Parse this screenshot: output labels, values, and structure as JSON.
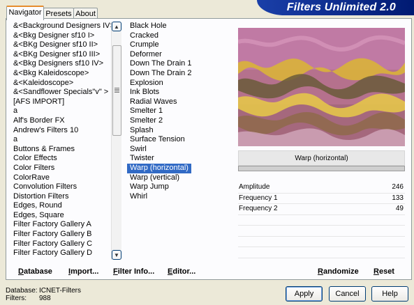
{
  "tabs": [
    "Navigator",
    "Presets",
    "About"
  ],
  "banner_title": "Filters Unlimited 2.0",
  "categories": [
    "&<Background Designers IV>",
    "&<Bkg Designer sf10 I>",
    "&<BKg Designer sf10 II>",
    "&<BKg Designer sf10 III>",
    "&<Bkg Designers sf10 IV>",
    "&<Bkg Kaleidoscope>",
    "&<Kaleidoscope>",
    "&<Sandflower Specials\"v\" >",
    "[AFS IMPORT]",
    "a",
    "Alf's Border FX",
    "Andrew's Filters 10",
    "a",
    "Buttons & Frames",
    "Color Effects",
    "Color Filters",
    "ColorRave",
    "Convolution Filters",
    "Distortion Filters",
    "Edges, Round",
    "Edges, Square",
    "Filter Factory Gallery A",
    "Filter Factory Gallery B",
    "Filter Factory Gallery C",
    "Filter Factory Gallery D"
  ],
  "selected_category": "Distortion Filters",
  "filters": [
    "Black Hole",
    "Cracked",
    "Crumple",
    "Deformer",
    "Down The Drain 1",
    "Down The Drain 2",
    "Explosion",
    "Ink Blots",
    "Radial Waves",
    "Smelter 1",
    "Smelter 2",
    "Splash",
    "Surface Tension",
    "Swirl",
    "Twister",
    "Warp (horizontal)",
    "Warp (vertical)",
    "Warp Jump",
    "Whirl"
  ],
  "selected_filter": "Warp (horizontal)",
  "filter_name": "Warp (horizontal)",
  "params": [
    {
      "label": "Amplitude",
      "value": "246"
    },
    {
      "label": "Frequency 1",
      "value": "133"
    },
    {
      "label": "Frequency 2",
      "value": "49"
    }
  ],
  "buttons": {
    "database": "Database",
    "import": "Import...",
    "filter_info": "Filter Info...",
    "editor": "Editor...",
    "randomize": "Randomize",
    "reset": "Reset",
    "apply": "Apply",
    "cancel": "Cancel",
    "help": "Help"
  },
  "footer": {
    "database_label": "Database:",
    "database_value": "ICNET-Filters",
    "filters_label": "Filters:",
    "filters_value": "988"
  },
  "colors": {
    "accent_selection": "#316ac5",
    "banner_blue": "#0c2a8a",
    "preview_pink": "#c67aa0",
    "preview_yellow": "#e6c23a"
  },
  "icons": [
    "scroll-up-arrow-icon",
    "scroll-down-arrow-icon"
  ]
}
